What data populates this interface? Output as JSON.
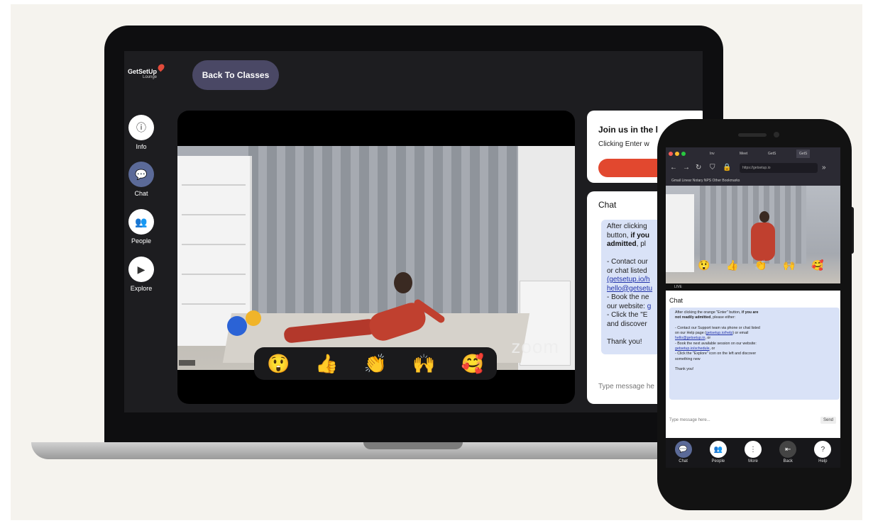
{
  "app": {
    "logo_text": "GetSetUp",
    "logo_sub": "Lounge"
  },
  "header": {
    "back_button": "Back To Classes"
  },
  "sidebar": {
    "items": [
      {
        "label": "Info",
        "icon": "info-icon"
      },
      {
        "label": "Chat",
        "icon": "chat-icon",
        "active": true
      },
      {
        "label": "People",
        "icon": "people-icon"
      },
      {
        "label": "Explore",
        "icon": "explore-icon"
      }
    ]
  },
  "video": {
    "watermark": "zoom",
    "reactions": [
      "😲",
      "👍",
      "👏",
      "🙌",
      "🥰"
    ]
  },
  "join_card": {
    "title": "Join us in the l",
    "subtitle": "Clicking Enter w"
  },
  "chat": {
    "title": "Chat",
    "msg_l1": "After clicking",
    "msg_l2a": "button, ",
    "msg_l2b": "if you",
    "msg_l3a": "admitted",
    "msg_l3b": ", pl",
    "msg_l4": "- Contact our",
    "msg_l5": "or chat listed",
    "msg_l6": "(getsetup.io/h",
    "msg_l7": "hello@getsetu",
    "msg_l8": "- Book the ne",
    "msg_l9a": "our website: ",
    "msg_l9b": "g",
    "msg_l10": "- Click the \"E",
    "msg_l11": "and discover",
    "msg_l12": "Thank you!",
    "input_placeholder": "Type message he"
  },
  "phone": {
    "tabs": [
      "Inv",
      "Meet",
      "GetS",
      "GetS"
    ],
    "address": "https://getsetup.io",
    "bookmarks": "Gmail   Linear   Notary   NPS            Other Bookmarks",
    "video_caption": "LIVE",
    "chat_title": "Chat",
    "msg_l1a": "After clicking the orange \"Enter\" button, ",
    "msg_l1b": "if you are",
    "msg_l2a": "not readily admitted",
    "msg_l2b": ", please either:",
    "msg_l3": "- Contact our Support team via phone or chat listed",
    "msg_l4a": "on our Help page (",
    "msg_l4b": "getsetup.io/help",
    "msg_l4c": ") or email",
    "msg_l5a": "hello@getsetup.io",
    "msg_l5b": ", or",
    "msg_l6": "- Book the next available session on our website:",
    "msg_l7a": "getsetup.io/schedule",
    "msg_l7b": ", or",
    "msg_l8": "- Click the \"Explore\" icon on the left and discover",
    "msg_l9": "something new",
    "msg_l10": "Thank you!",
    "input_placeholder": "Type message here...",
    "send_label": "Send",
    "nav": [
      {
        "label": "Chat",
        "icon": "chat-icon",
        "active": true
      },
      {
        "label": "People",
        "icon": "people-icon"
      },
      {
        "label": "More",
        "icon": "more-icon"
      },
      {
        "label": "Back",
        "icon": "back-icon"
      },
      {
        "label": "Help",
        "icon": "help-icon"
      }
    ]
  },
  "colors": {
    "accent": "#e2482f",
    "chat_bg": "#d9e2f7",
    "active_icon": "#5b6a98",
    "button_bg": "#4a4865"
  }
}
